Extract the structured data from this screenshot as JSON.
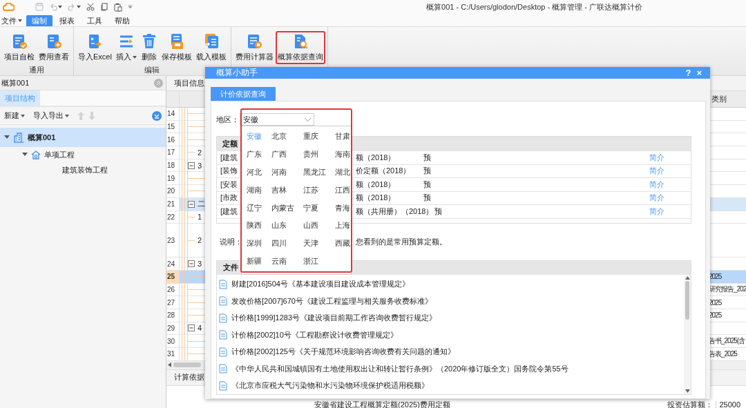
{
  "window": {
    "title": "概算001 - C:/Users/glodon/Desktop - 概算管理 - 广联达概算计价"
  },
  "menu": [
    {
      "label": "文件",
      "has_menu": true,
      "selected": false
    },
    {
      "label": "编制",
      "has_menu": false,
      "selected": true
    },
    {
      "label": "报表",
      "has_menu": false,
      "selected": false
    },
    {
      "label": "工具",
      "has_menu": false,
      "selected": false
    },
    {
      "label": "帮助",
      "has_menu": false,
      "selected": false
    }
  ],
  "ribbon": {
    "groups": [
      {
        "label": "通用",
        "buttons": [
          {
            "label": "项目自检",
            "kind": "check",
            "has_menu": false,
            "annotated": false
          },
          {
            "label": "费用查看",
            "kind": "view",
            "has_menu": false,
            "annotated": false
          }
        ]
      },
      {
        "label": "编辑",
        "buttons": [
          {
            "label": "导入Excel",
            "kind": "excel",
            "has_menu": false,
            "annotated": false
          },
          {
            "label": "插入",
            "kind": "insert",
            "has_menu": true,
            "annotated": false
          },
          {
            "label": "删除",
            "kind": "delete",
            "has_menu": false,
            "annotated": false
          },
          {
            "label": "保存模板",
            "kind": "save",
            "has_menu": false,
            "annotated": false
          },
          {
            "label": "载入模板",
            "kind": "load",
            "has_menu": false,
            "annotated": false
          }
        ]
      },
      {
        "buttons": [
          {
            "label": "费用计算器",
            "kind": "calculator",
            "has_menu": false,
            "annotated": false
          },
          {
            "label": "概算依据查询",
            "kind": "search",
            "has_menu": false,
            "annotated": true
          }
        ]
      }
    ]
  },
  "left_panel": {
    "title": "概算001",
    "tabs": [
      {
        "label": "项目结构",
        "selected": true
      }
    ],
    "toolbar": [
      {
        "label": "新建"
      },
      {
        "label": "导入导出"
      }
    ],
    "tree": [
      {
        "label": "概算001",
        "kind": "project",
        "selected": true,
        "children": [
          {
            "label": "单项工程",
            "kind": "unit",
            "selected": false,
            "children": [
              {
                "label": "建筑装饰工程",
                "kind": "leaf",
                "selected": false
              }
            ]
          }
        ]
      }
    ]
  },
  "grid": {
    "tab": "项目信息",
    "far_header": "类别",
    "rows": [
      {
        "number": "14",
        "kind": "line",
        "tall": false,
        "highlighted": false,
        "selected": false
      },
      {
        "number": "15",
        "kind": "line",
        "tall": false,
        "highlighted": false,
        "selected": false
      },
      {
        "number": "16",
        "kind": "line",
        "tall": false,
        "highlighted": false,
        "selected": false
      },
      {
        "number": "17",
        "kind": "item",
        "code": "2",
        "tall": false,
        "highlighted": false,
        "selected": false
      },
      {
        "number": "18",
        "kind": "group",
        "code": "3",
        "tall": false,
        "highlighted": false,
        "selected": false
      },
      {
        "number": "19",
        "kind": "line",
        "tall": false,
        "highlighted": false,
        "selected": false
      },
      {
        "number": "20",
        "kind": "line",
        "tall": false,
        "highlighted": false,
        "selected": false
      },
      {
        "number": "21",
        "kind": "group",
        "code": "二",
        "tall": false,
        "highlighted": true,
        "selected": false
      },
      {
        "number": "22",
        "kind": "item",
        "code": "1",
        "tall": false,
        "highlighted": false,
        "selected": false
      },
      {
        "number": "23",
        "kind": "item",
        "code": "2",
        "tall": true,
        "highlighted": false,
        "selected": false
      },
      {
        "number": "24",
        "kind": "group",
        "code": "3",
        "tall": false,
        "highlighted": false,
        "selected": false
      },
      {
        "number": "25",
        "kind": "line",
        "far": "2025",
        "tall": false,
        "highlighted": false,
        "selected": true
      },
      {
        "number": "26",
        "kind": "line",
        "far": "研究报告_202",
        "tall": false,
        "highlighted": false,
        "selected": false
      },
      {
        "number": "27",
        "kind": "line",
        "far": "2025",
        "tall": false,
        "highlighted": false,
        "selected": false
      },
      {
        "number": "28",
        "kind": "line",
        "far": "2025",
        "tall": false,
        "highlighted": false,
        "selected": false
      },
      {
        "number": "29",
        "kind": "group",
        "code": "4",
        "tall": false,
        "highlighted": false,
        "selected": false
      },
      {
        "number": "30",
        "kind": "line",
        "far": "告书_2025(含",
        "tall": false,
        "highlighted": false,
        "selected": false
      },
      {
        "number": "31",
        "kind": "line",
        "far": "告表_2025",
        "tall": false,
        "highlighted": false,
        "selected": false
      }
    ]
  },
  "bottom": {
    "tab": "计算依据",
    "title": "安徽省建设工程概算定额(2025)费用定额",
    "amount_label": "投资估算额：",
    "amount": "25000"
  },
  "dialog": {
    "title": "概算小助手",
    "help": "?",
    "close": "×",
    "tabs": [
      {
        "label": "计价依据查询",
        "selected": true
      }
    ],
    "region_label": "地区：",
    "region": "安徽",
    "region_expanded": true,
    "region_annotated": true,
    "region_options": [
      {
        "label": "安徽",
        "selected": true
      },
      {
        "label": "北京",
        "selected": false
      },
      {
        "label": "重庆",
        "selected": false
      },
      {
        "label": "甘肃",
        "selected": false
      },
      {
        "label": "广东",
        "selected": false
      },
      {
        "label": "广西",
        "selected": false
      },
      {
        "label": "贵州",
        "selected": false
      },
      {
        "label": "海南",
        "selected": false
      },
      {
        "label": "河北",
        "selected": false
      },
      {
        "label": "河南",
        "selected": false
      },
      {
        "label": "黑龙江",
        "selected": false
      },
      {
        "label": "湖北",
        "selected": false
      },
      {
        "label": "湖南",
        "selected": false
      },
      {
        "label": "吉林",
        "selected": false
      },
      {
        "label": "江苏",
        "selected": false
      },
      {
        "label": "江西",
        "selected": false
      },
      {
        "label": "辽宁",
        "selected": false
      },
      {
        "label": "内蒙古",
        "selected": false
      },
      {
        "label": "宁夏",
        "selected": false
      },
      {
        "label": "青海",
        "selected": false
      },
      {
        "label": "陕西",
        "selected": false
      },
      {
        "label": "山东",
        "selected": false
      },
      {
        "label": "山西",
        "selected": false
      },
      {
        "label": "上海",
        "selected": false
      },
      {
        "label": "深圳",
        "selected": false
      },
      {
        "label": "四川",
        "selected": false
      },
      {
        "label": "天津",
        "selected": false
      },
      {
        "label": "西藏",
        "selected": false
      },
      {
        "label": "新疆",
        "selected": false
      },
      {
        "label": "云南",
        "selected": false
      },
      {
        "label": "浙江",
        "selected": false
      }
    ],
    "quota": {
      "header": "定额",
      "rows": [
        {
          "column_1": "[建筑",
          "column_2": "额（2018）",
          "column_3": "预",
          "link": "简介"
        },
        {
          "column_1": "[装饰",
          "column_2": "价定额（2018）",
          "column_3": "预",
          "link": "简介"
        },
        {
          "column_1": "[安装",
          "column_2": "额（2018）",
          "column_3": "预",
          "link": "简介"
        },
        {
          "column_1": "[市政",
          "column_2": "额（2018）",
          "column_3": "预",
          "link": "简介"
        },
        {
          "column_1": "[建筑",
          "column_2": "额（共用册）（2018）",
          "column_3": "预",
          "link": "简介"
        }
      ]
    },
    "note_label": "说明：",
    "note": "您看到的是常用预算定额。",
    "files": {
      "header": "文件",
      "items": [
        "财建[2016]504号《基本建设项目建设成本管理规定》",
        "发改价格[2007]670号《建设工程监理与相关服务收费标准》",
        "计价格[1999]1283号《建设项目前期工作咨询收费暂行规定》",
        "计价格[2002]10号《工程勘察设计收费管理规定》",
        "计价格[2002]125号《关于规范环境影响咨询收费有关问题的通知》",
        "《中华人民共和国城镇国有土地使用权出让和转让暂行条例》（2020年修订版全文）国务院令第55号",
        "《北京市应税大气污染物和水污染物环境保护税适用税额》"
      ]
    }
  }
}
